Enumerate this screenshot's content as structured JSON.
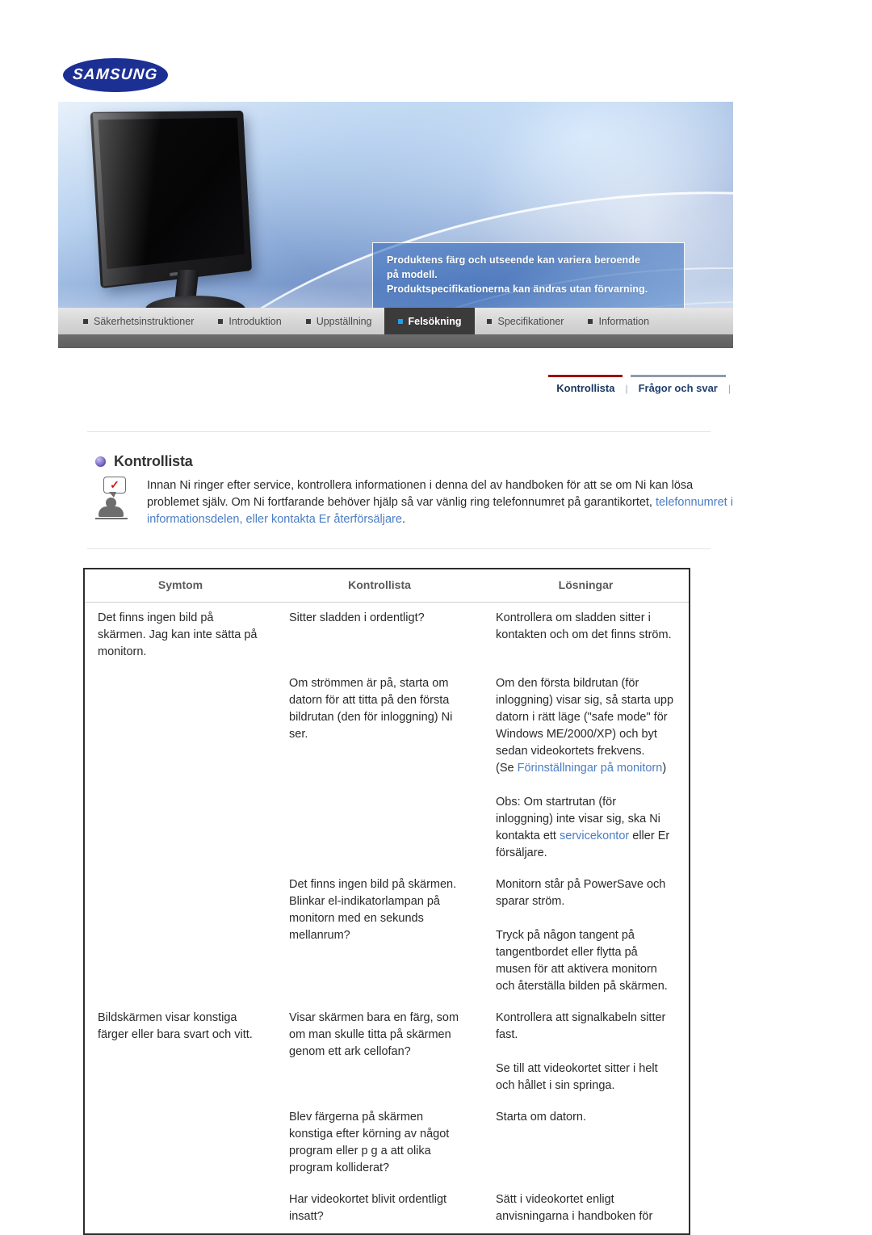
{
  "brand": {
    "logo_text": "SAMSUNG"
  },
  "banner": {
    "notice_lines": [
      "Produktens färg och utseende kan variera beroende",
      "på modell.",
      "Produktspecifikationerna kan ändras utan förvarning."
    ]
  },
  "nav": {
    "items": [
      {
        "label": "Säkerhetsinstruktioner",
        "active": false
      },
      {
        "label": "Introduktion",
        "active": false
      },
      {
        "label": "Uppställning",
        "active": false
      },
      {
        "label": "Felsökning",
        "active": true
      },
      {
        "label": "Specifikationer",
        "active": false
      },
      {
        "label": "Information",
        "active": false
      }
    ]
  },
  "subnav": {
    "tabs": [
      {
        "label": "Kontrollista",
        "active": true
      },
      {
        "label": "Frågor och svar",
        "active": false
      }
    ],
    "separator": "|"
  },
  "section": {
    "title": "Kontrollista",
    "intro": {
      "part1": "Innan Ni ringer efter service, kontrollera informationen i denna del av handboken för att se om Ni kan lösa problemet själv. Om Ni fortfarande behöver hjälp så var vänlig ring telefonnumret på garantikortet, ",
      "link": "telefonnumret i informationsdelen, eller kontakta Er återförsäljare",
      "part2": "."
    }
  },
  "table": {
    "headers": [
      "Symtom",
      "Kontrollista",
      "Lösningar"
    ],
    "rows": [
      {
        "symptom": "Det finns ingen bild på skärmen. Jag kan inte sätta på monitorn.",
        "check": "Sitter sladden i ordentligt?",
        "solution": "Kontrollera om sladden sitter i kontakten och om det finns ström."
      },
      {
        "symptom": "",
        "check": "Om strömmen är på, starta om datorn för att titta på den första bildrutan (den för inloggning) Ni ser.",
        "solution_pre": "Om den första bildrutan (för inloggning) visar sig, så starta upp datorn i rätt läge (\"safe mode\" för Windows ME/2000/XP) och byt sedan videokortets frekvens.",
        "solution_ref_open": "(Se ",
        "solution_ref_link": "Förinställningar på monitorn",
        "solution_ref_close": ")",
        "solution_note_pre": "Obs: Om startrutan (för inloggning) inte visar sig, ska Ni kontakta ett ",
        "solution_note_link": "servicekontor",
        "solution_note_post": " eller Er försäljare."
      },
      {
        "symptom": "",
        "check": "Det finns ingen bild på skärmen. Blinkar el-indikatorlampan på monitorn med en sekunds mellanrum?",
        "solution_a": "Monitorn står på PowerSave och sparar ström.",
        "solution_b": "Tryck på någon tangent på tangentbordet eller flytta på musen för att aktivera monitorn och återställa bilden på skärmen."
      },
      {
        "symptom": "Bildskärmen visar konstiga färger eller bara svart och vitt.",
        "check": "Visar skärmen bara en färg, som om man skulle titta på skärmen genom ett ark cellofan?",
        "solution_a": "Kontrollera att signalkabeln sitter fast.",
        "solution_b": "Se till att videokortet sitter i helt och hållet i sin springa."
      },
      {
        "symptom": "",
        "check": "Blev färgerna på skärmen konstiga efter körning av något program eller p g a att olika program kolliderat?",
        "solution": "Starta om datorn."
      },
      {
        "symptom": "",
        "check": "Har videokortet blivit ordentligt insatt?",
        "solution": "Sätt i videokortet enligt anvisningarna i handboken för"
      }
    ]
  },
  "colors": {
    "link": "#4a7dc4",
    "active_tab_bg": "#3b3b3b",
    "active_tab_bullet": "#1e9ff2",
    "subnav_active_rule": "#9c1212",
    "subnav_label": "#1f3f6e",
    "samsung_blue": "#1c2f93"
  }
}
